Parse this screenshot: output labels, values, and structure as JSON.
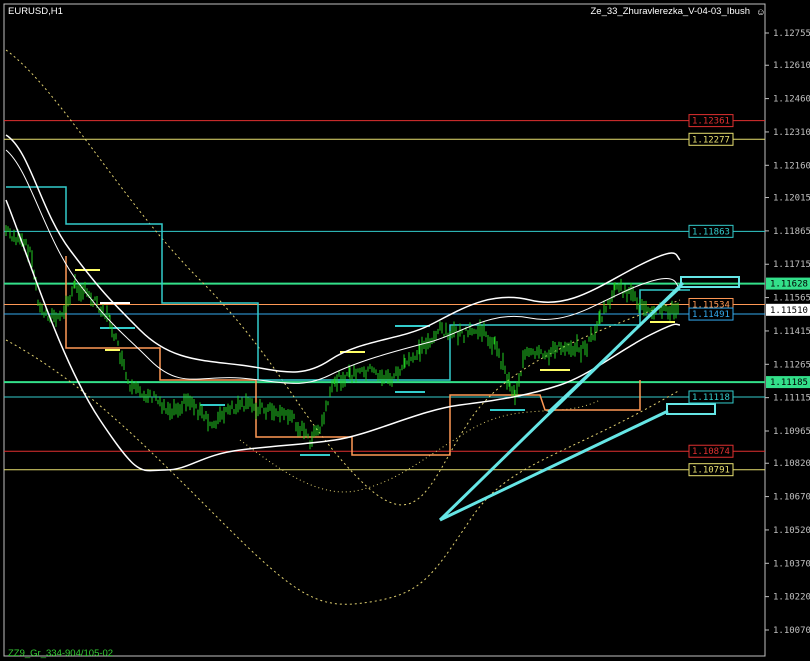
{
  "window": {
    "symbol_title": "EURUSD,H1",
    "indicator_title": "Ze_33_Zhuravlerezka_V-04-03_Ibush",
    "smiley": "☺",
    "footer_label": "ZZ9_Gr_334-904/105-02"
  },
  "colors": {
    "background": "#000000",
    "axis": "#c0c0c0",
    "candle": "#22cc22",
    "band": "#ffffff",
    "dotted_ma": "#e0d070",
    "steps_cyan": "#33cccc",
    "steps_orange": "#ff9955",
    "trendline": "#66e6e6",
    "level_red": "#e03030",
    "level_yellow": "#e8e070",
    "level_cyan": "#33cccc",
    "level_green": "#33e08a",
    "level_white": "#ffffff",
    "level_orange": "#ff9955"
  },
  "price_axis": {
    "ticks": [
      "1.12755",
      "1.12610",
      "1.12460",
      "1.12310",
      "1.12160",
      "1.12015",
      "1.11865",
      "1.11715",
      "1.11565",
      "1.11415",
      "1.11265",
      "1.11115",
      "1.10965",
      "1.10820",
      "1.10670",
      "1.10520",
      "1.10370",
      "1.10220",
      "1.10070"
    ],
    "current_price": "1.11510"
  },
  "levels": [
    {
      "name": "red-high",
      "price": "1.12361",
      "color": "#e03030"
    },
    {
      "name": "yellow-high",
      "price": "1.12277",
      "color": "#e8e070"
    },
    {
      "name": "cyan-upper",
      "price": "1.11863",
      "color": "#33cccc"
    },
    {
      "name": "green-upper",
      "price": "1.11628",
      "color": "#33e08a"
    },
    {
      "name": "orange-upper",
      "price": "1.11534",
      "color": "#ff9955"
    },
    {
      "name": "blue-mid",
      "price": "1.11491",
      "color": "#33aaee"
    },
    {
      "name": "green-lower",
      "price": "1.11185",
      "color": "#33e08a"
    },
    {
      "name": "cyan-lower",
      "price": "1.11118",
      "color": "#33cccc"
    },
    {
      "name": "red-low",
      "price": "1.10874",
      "color": "#e03030"
    },
    {
      "name": "yellow-low",
      "price": "1.10791",
      "color": "#e8e070"
    }
  ]
}
